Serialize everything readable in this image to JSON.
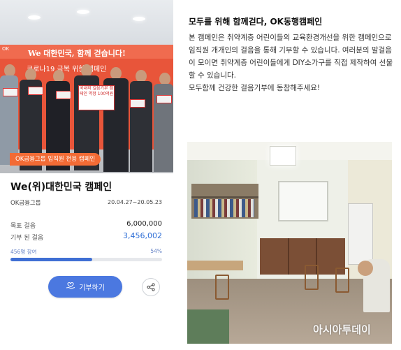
{
  "campaign": {
    "photo_tag": "OK금융그룹 임직원 전용 캠페인",
    "banner_line1": "We 대한민국, 함께 걷습니다!",
    "banner_line2": "코로나19 극복 위한 캠페인",
    "big_sign": "국내외 걸음기부 캠페인 약정 100억원",
    "title": "We(위)대한민국 캠페인",
    "organization": "OK금융그룹",
    "period": "20.04.27~20.05.23",
    "goal_label": "목표 걸음",
    "goal_value": "6,000,000",
    "donated_label": "기부 된 걸음",
    "donated_value": "3,456,002",
    "participants": "456명 참여",
    "percent_label": "54%",
    "progress_fraction": 0.54,
    "donate_button": "기부하기",
    "donate_icon": "hand-heart-icon",
    "share_icon": "share-icon",
    "accent_color": "#4b78e0",
    "tag_color": "#f26b35"
  },
  "article": {
    "headline": "모두를 위해 함께걷다, OK동행캠페인",
    "paragraphs": [
      "본 캠페인은 취약계층 어린이들의 교육환경개선을 위한 캠페인으로 임직원 개개인의 걸음을 통해 기부할 수 있습니다. 여러분의 발걸음이 모이면 취약계층 어린이들에게 DIY소가구를 직접 제작하여 선물할 수 있습니다.",
      "모두함께 건강한 걸음기부에 동참해주세요!"
    ],
    "watermark": "아시아투데이"
  }
}
